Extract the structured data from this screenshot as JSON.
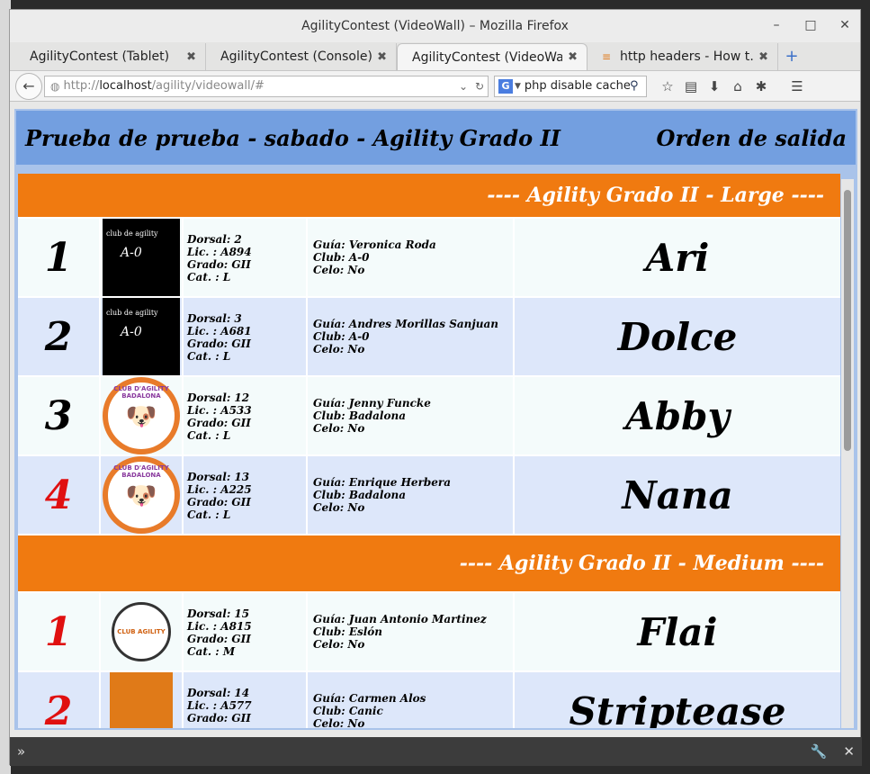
{
  "window": {
    "title": "AgilityContest (VideoWall) – Mozilla Firefox"
  },
  "tabs": [
    {
      "label": "AgilityContest (Tablet)"
    },
    {
      "label": "AgilityContest (Console)"
    },
    {
      "label": "AgilityContest (VideoWall)"
    },
    {
      "label": "http headers - How t…"
    }
  ],
  "nav": {
    "url_prefix": "http://",
    "url_host": "localhost",
    "url_path": "/agility/videowall/#",
    "search_query": "php disable cache",
    "search_engine": "G"
  },
  "page": {
    "header_left": "Prueba de prueba - sabado - Agility Grado II",
    "header_right": "Orden de salida",
    "categories": [
      {
        "title": "---- Agility Grado II - Large ----",
        "rows": [
          {
            "order": "1",
            "order_color": "#000000",
            "logo": "club-de-agility-a0",
            "dorsal": "Dorsal: 2",
            "lic": "Lic. : A894",
            "grado": "Grado: GII",
            "cat": "Cat. : L",
            "guia": "Guía: Veronica Roda",
            "club": "Club: A-0",
            "celo": "Celo: No",
            "name": "Ari"
          },
          {
            "order": "2",
            "order_color": "#000000",
            "logo": "club-de-agility-a0",
            "dorsal": "Dorsal: 3",
            "lic": "Lic. : A681",
            "grado": "Grado: GII",
            "cat": "Cat. : L",
            "guia": "Guía: Andres Morillas Sanjuan",
            "club": "Club: A-0",
            "celo": "Celo: No",
            "name": "Dolce"
          },
          {
            "order": "3",
            "order_color": "#000000",
            "logo": "club-agility-badalona",
            "dorsal": "Dorsal: 12",
            "lic": "Lic. : A533",
            "grado": "Grado: GII",
            "cat": "Cat. : L",
            "guia": "Guía: Jenny Funcke",
            "club": "Club: Badalona",
            "celo": "Celo: No",
            "name": "Abby"
          },
          {
            "order": "4",
            "order_color": "#e01010",
            "logo": "club-agility-badalona",
            "dorsal": "Dorsal: 13",
            "lic": "Lic. : A225",
            "grado": "Grado: GII",
            "cat": "Cat. : L",
            "guia": "Guía: Enrique Herbera",
            "club": "Club: Badalona",
            "celo": "Celo: No",
            "name": "Nana"
          }
        ]
      },
      {
        "title": "---- Agility Grado II - Medium ----",
        "rows": [
          {
            "order": "1",
            "order_color": "#e01010",
            "logo": "club-agility-eslon",
            "dorsal": "Dorsal: 15",
            "lic": "Lic. : A815",
            "grado": "Grado: GII",
            "cat": "Cat. : M",
            "guia": "Guía: Juan Antonio Martinez",
            "club": "Club: Eslón",
            "celo": "Celo: No",
            "name": "Flai"
          },
          {
            "order": "2",
            "order_color": "#e01010",
            "logo": "club-canic",
            "dorsal": "Dorsal: 14",
            "lic": "Lic. : A577",
            "grado": "Grado: GII",
            "cat": "",
            "guia": "Guía: Carmen Alos",
            "club": "Club: Canic",
            "celo": "Celo: No",
            "name": "Striptease"
          }
        ]
      }
    ]
  },
  "colors": {
    "header_bg": "#739fe0",
    "category_bg": "#f07a10",
    "row_odd": "#f4fbfb",
    "row_even": "#dde7fa",
    "highlight_red": "#e01010"
  }
}
